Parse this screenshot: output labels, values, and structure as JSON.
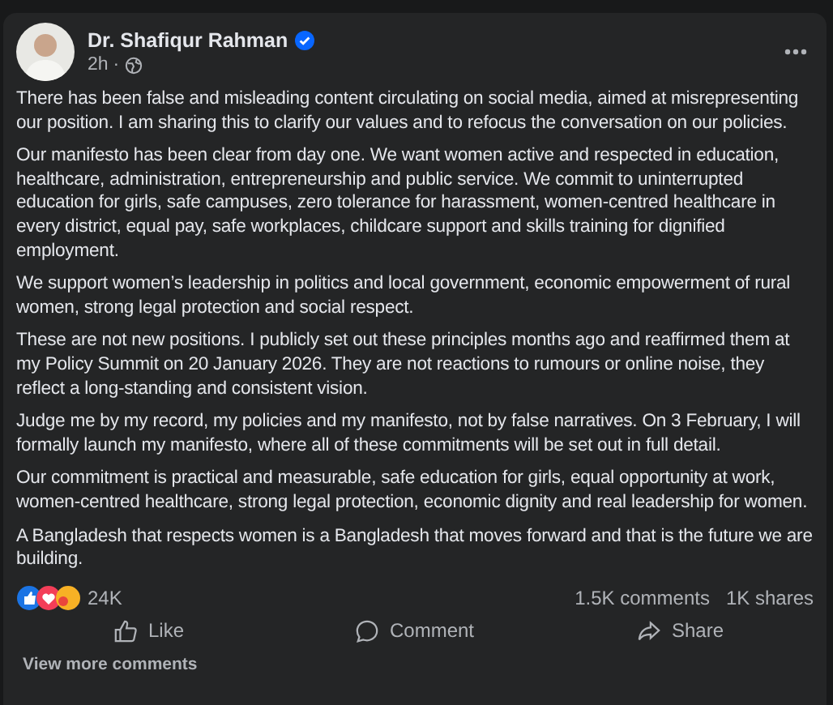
{
  "post": {
    "author": "Dr. Shafiqur Rahman",
    "verified": true,
    "time": "2h",
    "separator": "·",
    "paragraphs": [
      "There has been false and misleading content circulating on social media, aimed at misrepresenting our position. I am sharing this to clarify our values and to refocus the conversation on our policies.",
      "Our manifesto has been clear from day one. We want women active and respected in education, healthcare, administration, entrepreneurship and public service. We commit to uninterrupted education for girls, safe campuses, zero tolerance for harassment, women-centred healthcare in every district, equal pay, safe workplaces, childcare support and skills training for dignified employment.",
      "We support women’s leadership in politics and local government, economic empowerment of rural women, strong legal protection and social respect.",
      "These are not new positions. I publicly set out these principles months ago and reaffirmed them at my Policy Summit on 20 January 2026. They are not reactions to rumours or online noise, they reflect a long-standing and consistent vision.",
      "Judge me by my record, my policies and my manifesto, not by false narratives. On 3 February, I will formally launch my manifesto, where all of these commitments will be set out in full detail.",
      "Our commitment is practical and measurable, safe education for girls, equal opportunity at work, women-centred healthcare, strong legal protection, economic dignity and real leadership for women.",
      "A Bangladesh that respects women is a Bangladesh that moves forward and that is the future we are building."
    ],
    "reactions_count": "24K",
    "comments_count": "1.5K comments",
    "shares_count": "1K shares",
    "actions": [
      {
        "kind": "like",
        "label": "Like"
      },
      {
        "kind": "comment",
        "label": "Comment"
      },
      {
        "kind": "share",
        "label": "Share"
      }
    ],
    "view_more": "View more comments"
  }
}
